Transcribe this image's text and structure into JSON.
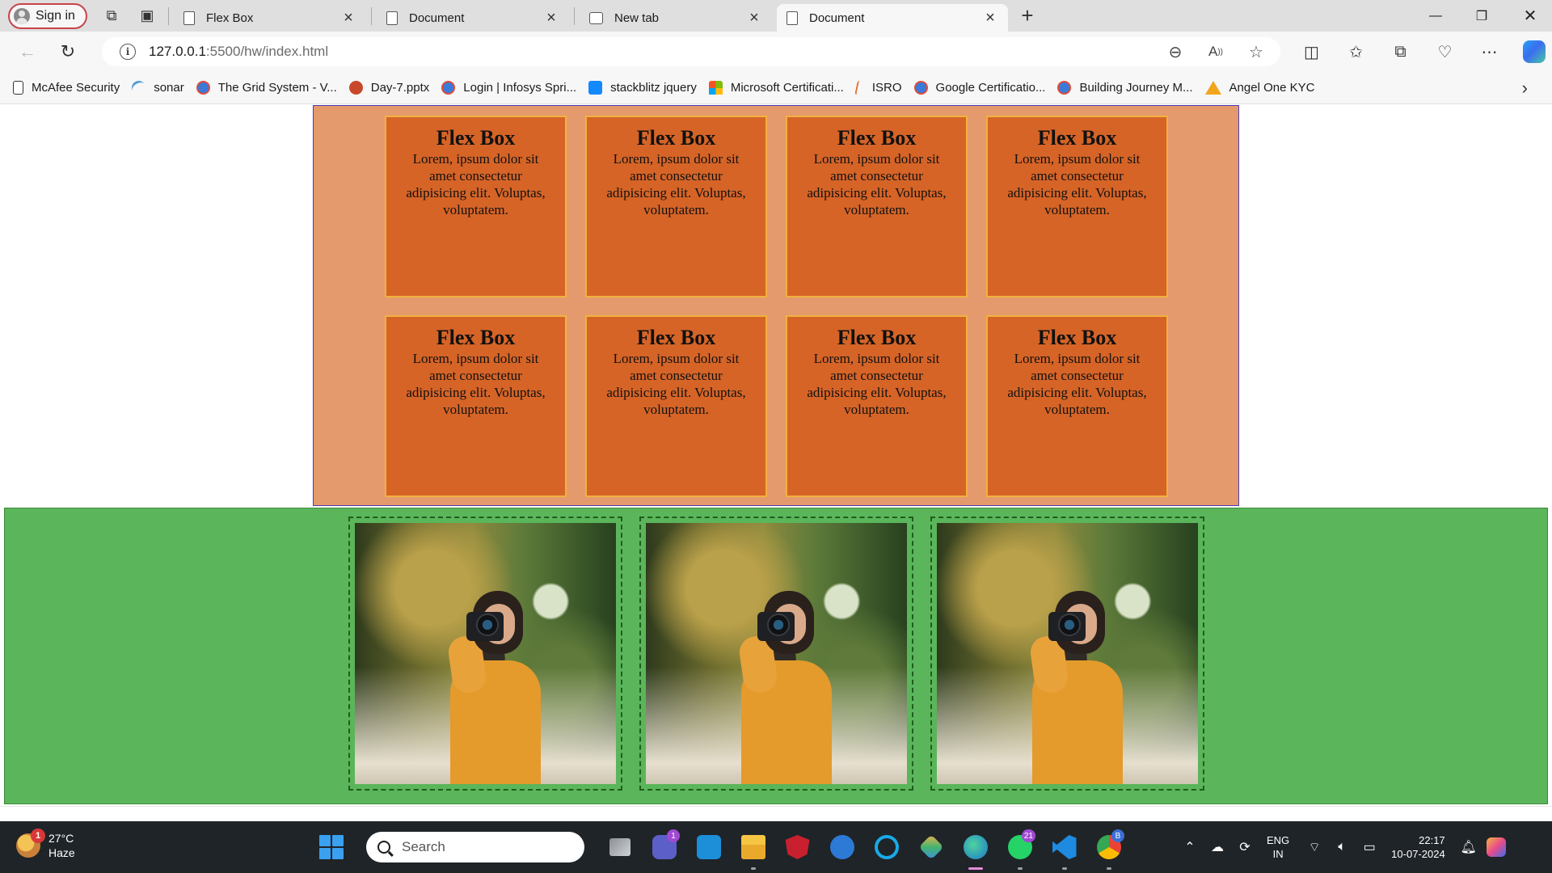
{
  "browser": {
    "sign_in_label": "Sign in",
    "tabs": [
      {
        "title": "Flex Box",
        "icon": "page-icon",
        "active": false
      },
      {
        "title": "Document",
        "icon": "page-icon",
        "active": false
      },
      {
        "title": "New tab",
        "icon": "new-tab-page-icon",
        "active": false
      },
      {
        "title": "Document",
        "icon": "page-icon",
        "active": true
      }
    ],
    "address": {
      "host": "127.0.0.1",
      "path": ":5500/hw/index.html"
    },
    "favorites": [
      {
        "label": "McAfee Security",
        "icon": "page-icon"
      },
      {
        "label": "sonar",
        "icon": "sonar-icon"
      },
      {
        "label": "The Grid System - V...",
        "icon": "globe-icon"
      },
      {
        "label": "Day-7.pptx",
        "icon": "powerpoint-icon"
      },
      {
        "label": "Login | Infosys Spri...",
        "icon": "globe-icon"
      },
      {
        "label": "stackblitz jquery",
        "icon": "stackblitz-icon"
      },
      {
        "label": "Microsoft Certificati...",
        "icon": "microsoft-icon"
      },
      {
        "label": "ISRO",
        "icon": "isro-icon"
      },
      {
        "label": "Google Certificatio...",
        "icon": "globe-icon"
      },
      {
        "label": "Building Journey M...",
        "icon": "globe-icon"
      },
      {
        "label": "Angel One KYC",
        "icon": "angel-one-icon"
      }
    ]
  },
  "page": {
    "flex_boxes": [
      {
        "title": "Flex Box",
        "text": "Lorem, ipsum dolor sit amet consectetur adipisicing elit. Voluptas, voluptatem."
      },
      {
        "title": "Flex Box",
        "text": "Lorem, ipsum dolor sit amet consectetur adipisicing elit. Voluptas, voluptatem."
      },
      {
        "title": "Flex Box",
        "text": "Lorem, ipsum dolor sit amet consectetur adipisicing elit. Voluptas, voluptatem."
      },
      {
        "title": "Flex Box",
        "text": "Lorem, ipsum dolor sit amet consectetur adipisicing elit. Voluptas, voluptatem."
      },
      {
        "title": "Flex Box",
        "text": "Lorem, ipsum dolor sit amet consectetur adipisicing elit. Voluptas, voluptatem."
      },
      {
        "title": "Flex Box",
        "text": "Lorem, ipsum dolor sit amet consectetur adipisicing elit. Voluptas, voluptatem."
      },
      {
        "title": "Flex Box",
        "text": "Lorem, ipsum dolor sit amet consectetur adipisicing elit. Voluptas, voluptatem."
      },
      {
        "title": "Flex Box",
        "text": "Lorem, ipsum dolor sit amet consectetur adipisicing elit. Voluptas, voluptatem."
      }
    ],
    "photo_count": 3,
    "colors": {
      "flex_container_bg": "#e59a6d",
      "flex_box_bg": "#d66427",
      "flex_box_border": "#f2b13e",
      "gallery_bg": "#5bb55a"
    }
  },
  "taskbar": {
    "weather": {
      "temp": "27°C",
      "condition": "Haze",
      "badge": "1"
    },
    "search_label": "Search",
    "apps": [
      {
        "name": "task-view-icon",
        "badge": ""
      },
      {
        "name": "teams-icon",
        "badge": "1"
      },
      {
        "name": "myhp-icon",
        "badge": ""
      },
      {
        "name": "file-explorer-icon",
        "badge": ""
      },
      {
        "name": "mcafee-icon",
        "badge": ""
      },
      {
        "name": "get-help-icon",
        "badge": ""
      },
      {
        "name": "cortana-icon",
        "badge": ""
      },
      {
        "name": "snipping-tool-icon",
        "badge": ""
      },
      {
        "name": "edge-icon",
        "badge": ""
      },
      {
        "name": "whatsapp-icon",
        "badge": "21"
      },
      {
        "name": "vscode-icon",
        "badge": ""
      },
      {
        "name": "chrome-icon",
        "badge": "B"
      }
    ],
    "lang_line1": "ENG",
    "lang_line2": "IN",
    "time": "22:17",
    "date": "10-07-2024"
  }
}
